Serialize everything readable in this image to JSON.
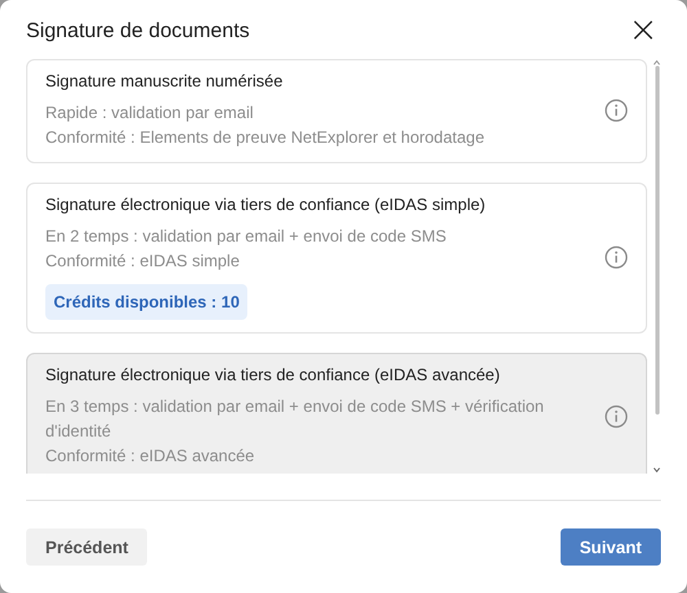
{
  "dialog": {
    "title": "Signature de documents",
    "close": "×"
  },
  "options": [
    {
      "title": "Signature manuscrite numérisée",
      "lines": [
        "Rapide : validation par email",
        "Conformité : Elements de preuve NetExplorer et horodatage"
      ],
      "selected": false
    },
    {
      "title": "Signature électronique via tiers de confiance (eIDAS simple)",
      "lines": [
        "En 2 temps : validation par email + envoi de code SMS",
        "Conformité : eIDAS simple"
      ],
      "credits": "Crédits disponibles : 10",
      "selected": false
    },
    {
      "title": "Signature électronique via tiers de confiance (eIDAS avancée)",
      "lines": [
        "En 3 temps : validation par email + envoi de code SMS + vérification d'identité",
        "Conformité : eIDAS avancée"
      ],
      "selected": true
    }
  ],
  "buttons": {
    "back": "Précédent",
    "next": "Suivant"
  }
}
